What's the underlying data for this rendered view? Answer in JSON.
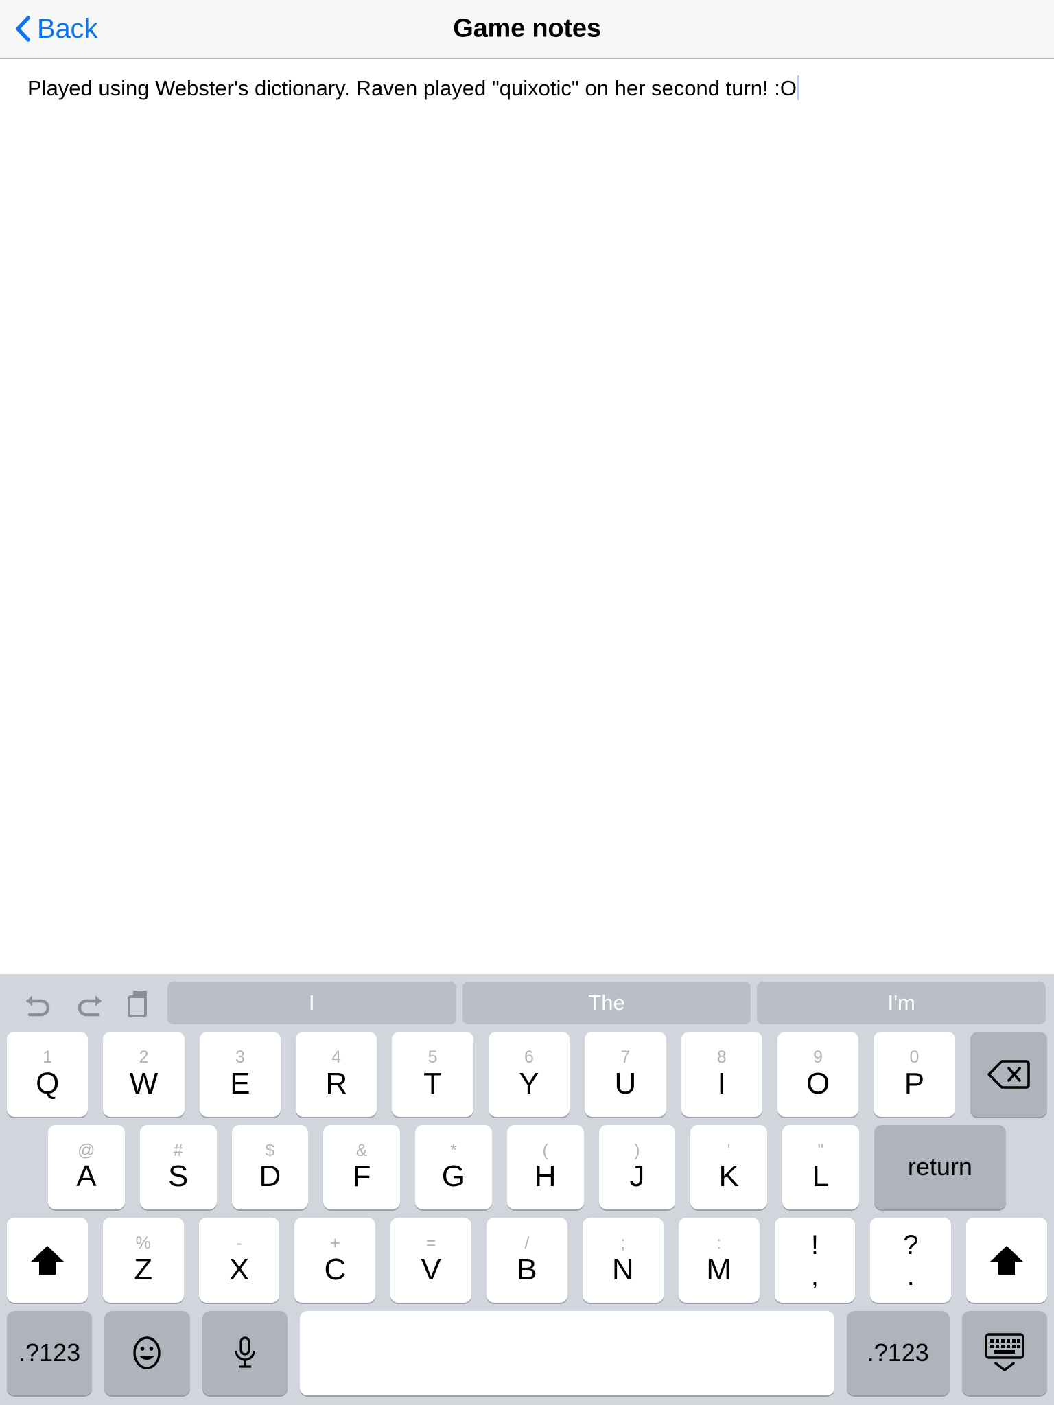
{
  "navbar": {
    "back_label": "Back",
    "back_icon": "chevron-left-icon",
    "title": "Game notes"
  },
  "note": {
    "text": "Played using Webster's dictionary. Raven played \"quixotic\" on her second turn! :O",
    "caret_visible": true
  },
  "keyboard": {
    "toolbar": {
      "icons": [
        {
          "name": "undo-icon",
          "label": "undo"
        },
        {
          "name": "redo-icon",
          "label": "redo"
        },
        {
          "name": "paste-icon",
          "label": "paste"
        }
      ],
      "suggestions": [
        "I",
        "The",
        "I'm"
      ]
    },
    "rows": [
      {
        "id": "row1",
        "keys": [
          {
            "alt": "1",
            "main": "Q"
          },
          {
            "alt": "2",
            "main": "W"
          },
          {
            "alt": "3",
            "main": "E"
          },
          {
            "alt": "4",
            "main": "R"
          },
          {
            "alt": "5",
            "main": "T"
          },
          {
            "alt": "6",
            "main": "Y"
          },
          {
            "alt": "7",
            "main": "U"
          },
          {
            "alt": "8",
            "main": "I"
          },
          {
            "alt": "9",
            "main": "O"
          },
          {
            "alt": "0",
            "main": "P"
          },
          {
            "icon": "backspace-icon",
            "main": ""
          }
        ]
      },
      {
        "id": "row2",
        "keys": [
          {
            "alt": "@",
            "main": "A"
          },
          {
            "alt": "#",
            "main": "S"
          },
          {
            "alt": "$",
            "main": "D"
          },
          {
            "alt": "&",
            "main": "F"
          },
          {
            "alt": "*",
            "main": "G"
          },
          {
            "alt": "(",
            "main": "H"
          },
          {
            "alt": ")",
            "main": "J"
          },
          {
            "alt": "'",
            "main": "K"
          },
          {
            "alt": "\"",
            "main": "L"
          },
          {
            "main": "return"
          }
        ]
      },
      {
        "id": "row3",
        "keys": [
          {
            "icon": "shift-icon",
            "main": ""
          },
          {
            "alt": "%",
            "main": "Z"
          },
          {
            "alt": "-",
            "main": "X"
          },
          {
            "alt": "+",
            "main": "C"
          },
          {
            "alt": "=",
            "main": "V"
          },
          {
            "alt": "/",
            "main": "B"
          },
          {
            "alt": ";",
            "main": "N"
          },
          {
            "alt": ":",
            "main": "M"
          },
          {
            "alt": "!",
            "main": ","
          },
          {
            "alt": "?",
            "main": "."
          },
          {
            "icon": "shift-icon",
            "main": ""
          }
        ]
      },
      {
        "id": "row4",
        "keys": [
          {
            "main": ".?123"
          },
          {
            "icon": "emoji-icon",
            "main": ""
          },
          {
            "icon": "microphone-icon",
            "main": ""
          },
          {
            "main": ""
          },
          {
            "main": ".?123"
          },
          {
            "icon": "dismiss-keyboard-icon",
            "main": ""
          }
        ]
      }
    ]
  },
  "colors": {
    "accent_blue": "#0b76ef",
    "navbar_bg": "#f7f7f7",
    "keyboard_bg": "#d1d5dc",
    "key_white": "#ffffff",
    "key_dark": "#aeb3bc",
    "suggestion_bg": "#b9bec7",
    "alt_text": "#b0b4ba",
    "caret": "#b9cbe8"
  }
}
